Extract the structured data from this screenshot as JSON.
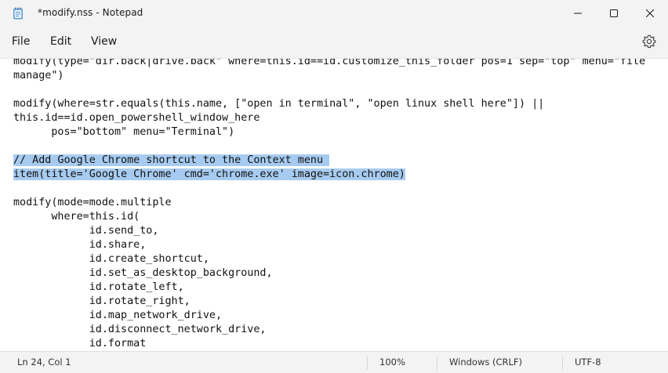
{
  "window": {
    "title": "*modify.nss - Notepad"
  },
  "icons": {
    "app": "notepad-icon",
    "minimize": "minimize-icon",
    "maximize": "maximize-icon",
    "close": "close-icon",
    "settings": "gear-icon"
  },
  "menu": {
    "file": "File",
    "edit": "Edit",
    "view": "View"
  },
  "editor": {
    "lines": [
      "modify(type=\"dir.back|drive.back\" where=this.id==id.customize_this_folder pos=1 sep=\"top\" menu=\"file",
      "manage\")",
      "",
      "modify(where=str.equals(this.name, [\"open in terminal\", \"open linux shell here\"]) ||",
      "this.id==id.open_powershell_window_here",
      "      pos=\"bottom\" menu=\"Terminal\")",
      "",
      "// Add Google Chrome shortcut to the Context menu ",
      "item(title='Google Chrome' cmd='chrome.exe' image=icon.chrome)",
      "",
      "modify(mode=mode.multiple",
      "      where=this.id(",
      "            id.send_to,",
      "            id.share,",
      "            id.create_shortcut,",
      "            id.set_as_desktop_background,",
      "            id.rotate_left,",
      "            id.rotate_right,",
      "            id.map_network_drive,",
      "            id.disconnect_network_drive,",
      "            id.format"
    ],
    "selected_lines": [
      7,
      8
    ]
  },
  "status": {
    "position": "Ln 24, Col 1",
    "zoom": "100%",
    "line_ending": "Windows (CRLF)",
    "encoding": "UTF-8"
  },
  "colors": {
    "selection": "#a7cbf0",
    "chrome": "#f3f3f3",
    "editor_bg": "#ffffff"
  }
}
